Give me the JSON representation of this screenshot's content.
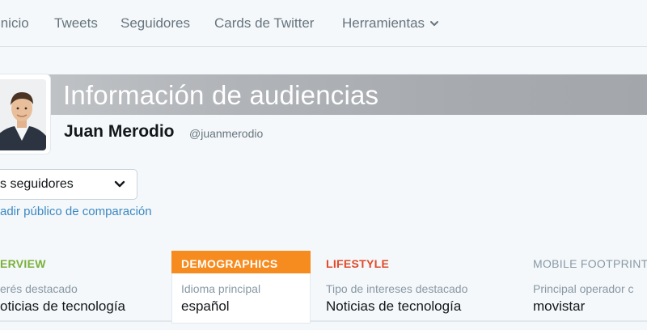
{
  "nav": {
    "items": [
      "Inicio",
      "Tweets",
      "Seguidores",
      "Cards de Twitter",
      "Herramientas"
    ]
  },
  "header": {
    "title": "Información de audiencias"
  },
  "user": {
    "name": "Juan Merodio",
    "handle": "@juanmerodio"
  },
  "audience_select": {
    "value": "s seguidores"
  },
  "compare_link": "adir público de comparación",
  "tabs": [
    {
      "title": "ERVIEW",
      "subtitle": "erés destacado",
      "value": "oticias de tecnología",
      "color": "#7ab03b"
    },
    {
      "title": "DEMOGRAPHICS",
      "subtitle": "Idioma principal",
      "value": "español",
      "color": "#ffffff",
      "active": true
    },
    {
      "title": "LIFESTYLE",
      "subtitle": "Tipo de intereses destacado",
      "value": "Noticias de tecnología",
      "color": "#e0492a"
    },
    {
      "title": "MOBILE FOOTPRINT",
      "subtitle": "Principal operador c",
      "value": "movistar",
      "color": "#8899a6"
    }
  ],
  "colors": {
    "active_tab": "#f68b1f",
    "link": "#3b88c3"
  },
  "icons": {
    "nav_chevron": "chevron-down-icon",
    "select_chevron": "chevron-down-icon"
  }
}
